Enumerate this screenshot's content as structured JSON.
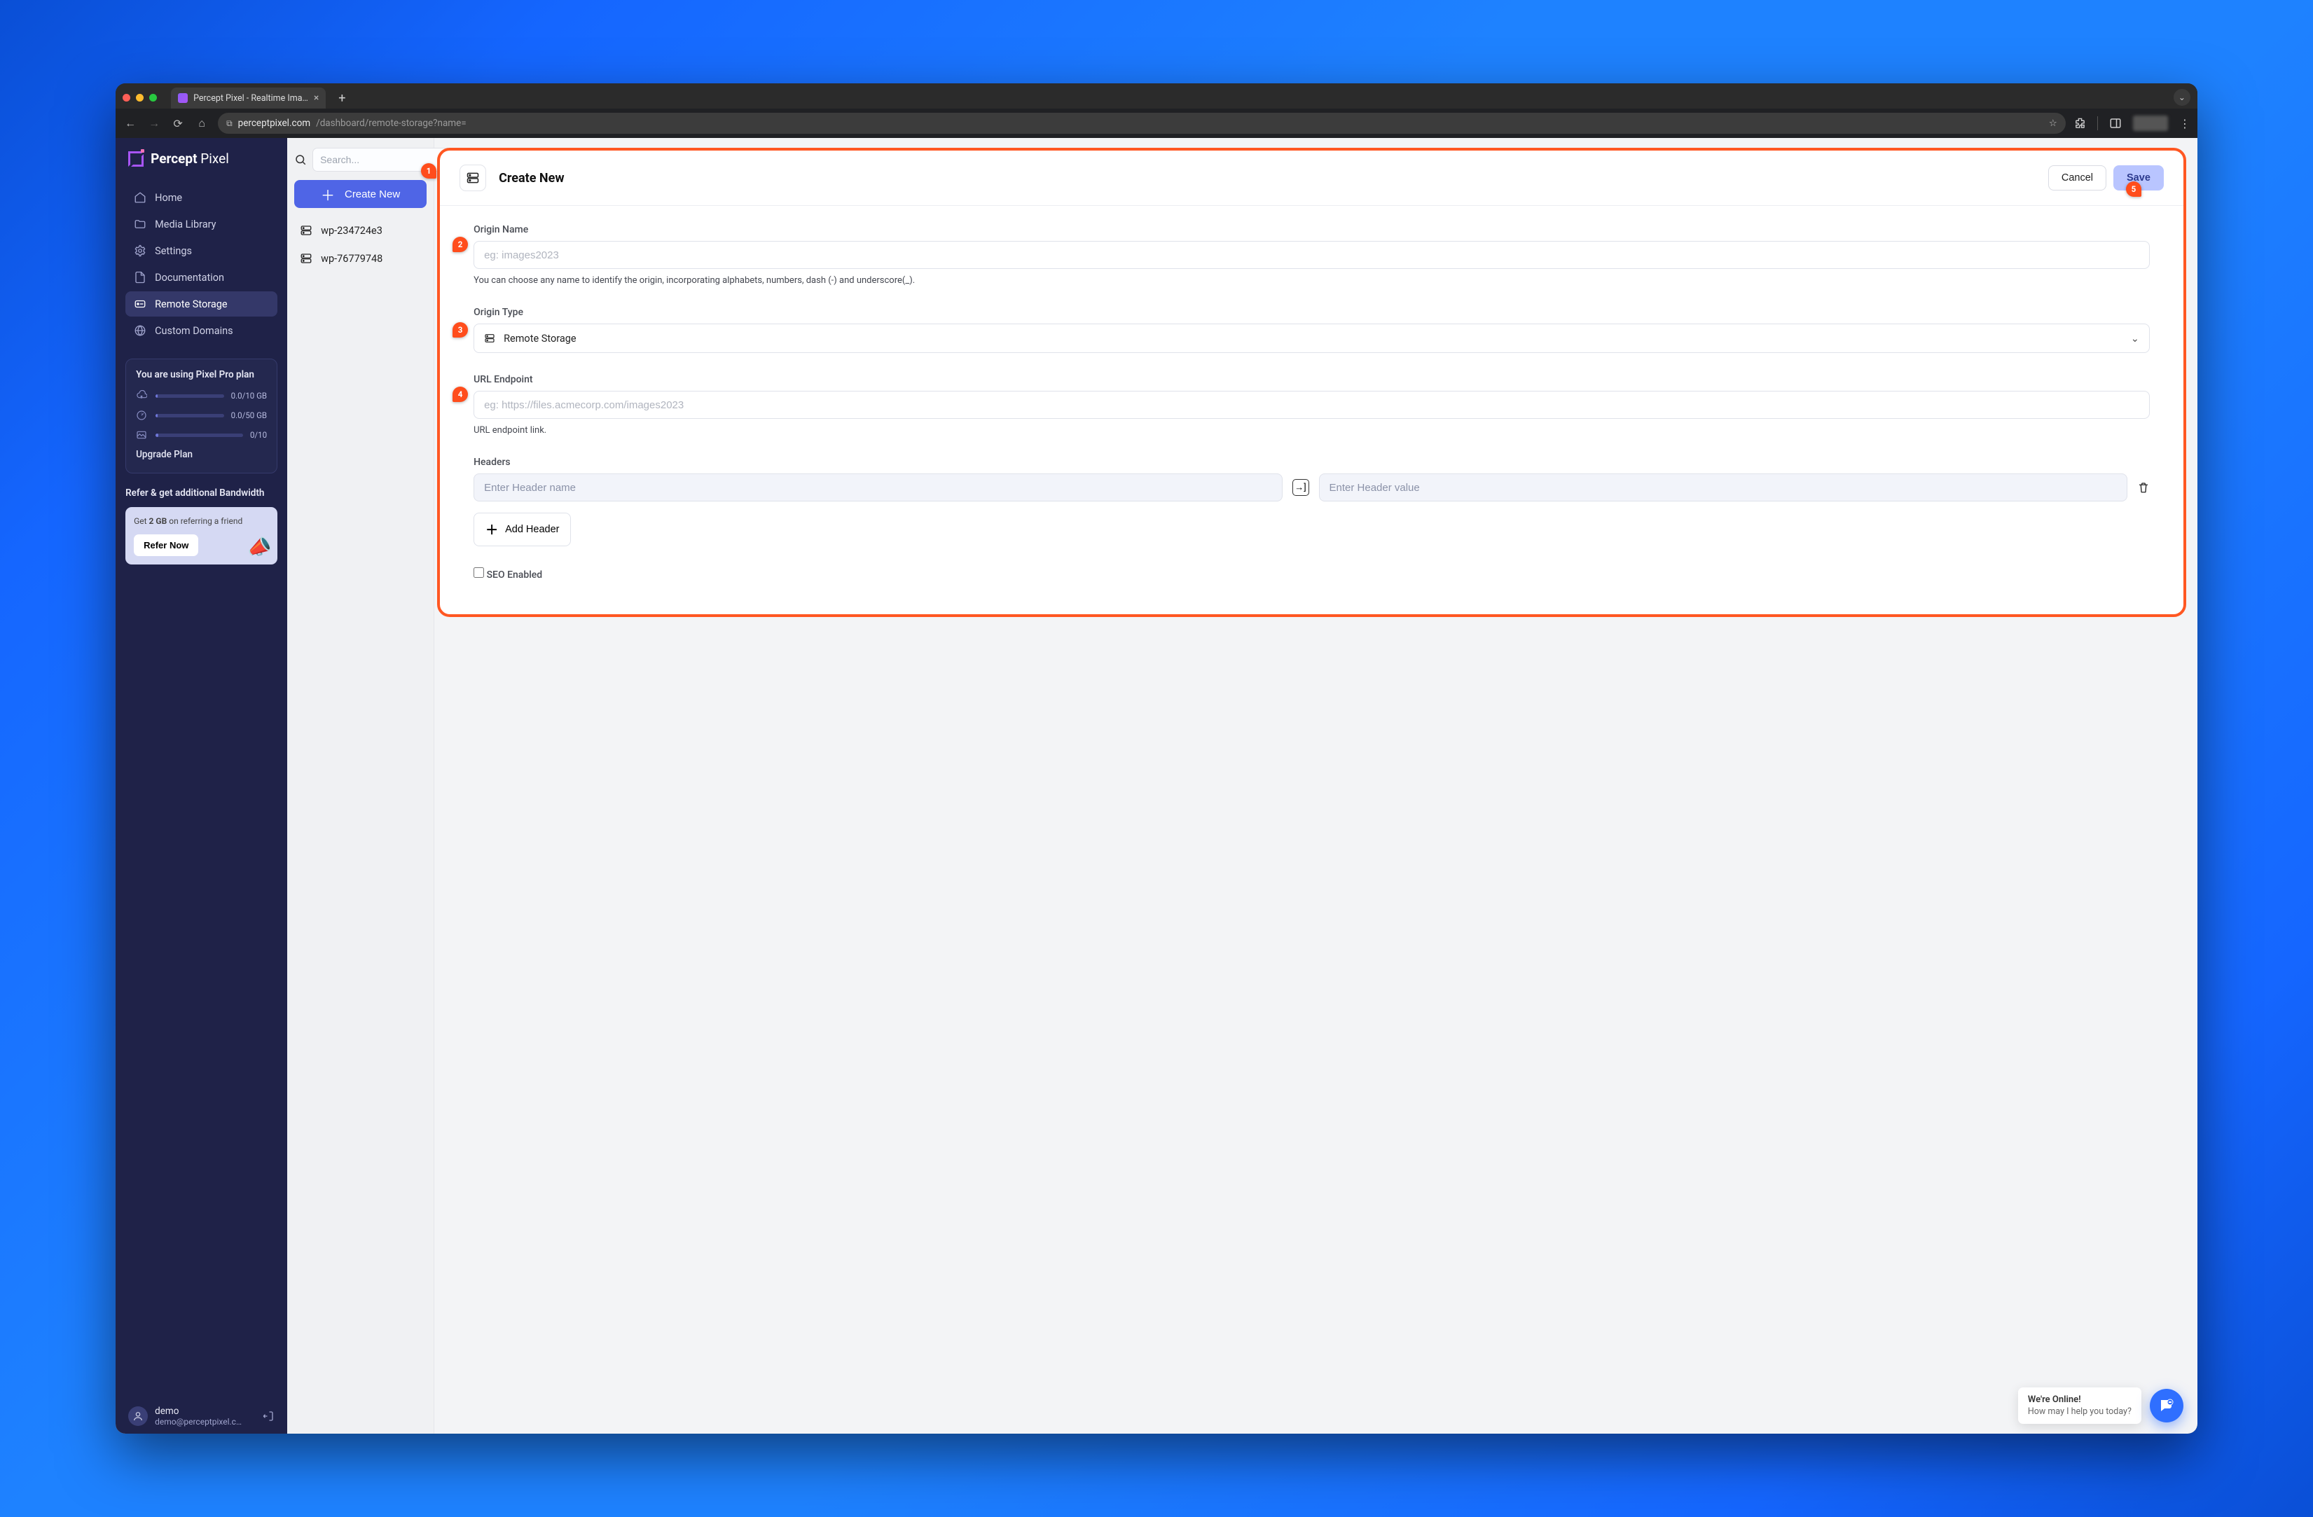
{
  "browser": {
    "tab_title": "Percept Pixel - Realtime Ima…",
    "url_host": "perceptpixel.com",
    "url_path": "/dashboard/remote-storage?name="
  },
  "brand": {
    "name_bold": "Percept",
    "name_thin": "Pixel"
  },
  "sidebar": {
    "items": [
      {
        "label": "Home"
      },
      {
        "label": "Media Library"
      },
      {
        "label": "Settings"
      },
      {
        "label": "Documentation"
      },
      {
        "label": "Remote Storage"
      },
      {
        "label": "Custom Domains"
      }
    ]
  },
  "plan": {
    "heading": "You are using Pixel Pro plan",
    "rows": [
      {
        "value": "0.0/10 GB",
        "fill": 0
      },
      {
        "value": "0.0/50 GB",
        "fill": 0
      },
      {
        "value": "0/10",
        "fill": 0
      }
    ],
    "upgrade": "Upgrade Plan"
  },
  "refer": {
    "heading": "Refer & get additional Bandwidth",
    "line_pre": "Get ",
    "line_strong": "2 GB",
    "line_post": " on referring a friend",
    "button": "Refer Now"
  },
  "user": {
    "name": "demo",
    "email": "demo@perceptpixel.c…"
  },
  "listcol": {
    "search_placeholder": "Search...",
    "create_label": "Create New",
    "items": [
      {
        "label": "wp-234724e3"
      },
      {
        "label": "wp-76779748"
      }
    ]
  },
  "callouts": {
    "c1": "1",
    "c2": "2",
    "c3": "3",
    "c4": "4",
    "c5": "5"
  },
  "panel": {
    "title": "Create New",
    "cancel": "Cancel",
    "save": "Save",
    "origin_name": {
      "label": "Origin Name",
      "placeholder": "eg: images2023",
      "hint": "You can choose any name to identify the origin, incorporating alphabets, numbers, dash (-) and underscore(_)."
    },
    "origin_type": {
      "label": "Origin Type",
      "value": "Remote Storage"
    },
    "url_endpoint": {
      "label": "URL Endpoint",
      "placeholder": "eg: https://files.acmecorp.com/images2023",
      "hint": "URL endpoint link."
    },
    "headers": {
      "label": "Headers",
      "name_placeholder": "Enter Header name",
      "value_placeholder": "Enter Header value",
      "add": "Add Header"
    },
    "seo_label": "SEO Enabled"
  },
  "chat": {
    "line1": "We're Online!",
    "line2": "How may I help you today?"
  }
}
